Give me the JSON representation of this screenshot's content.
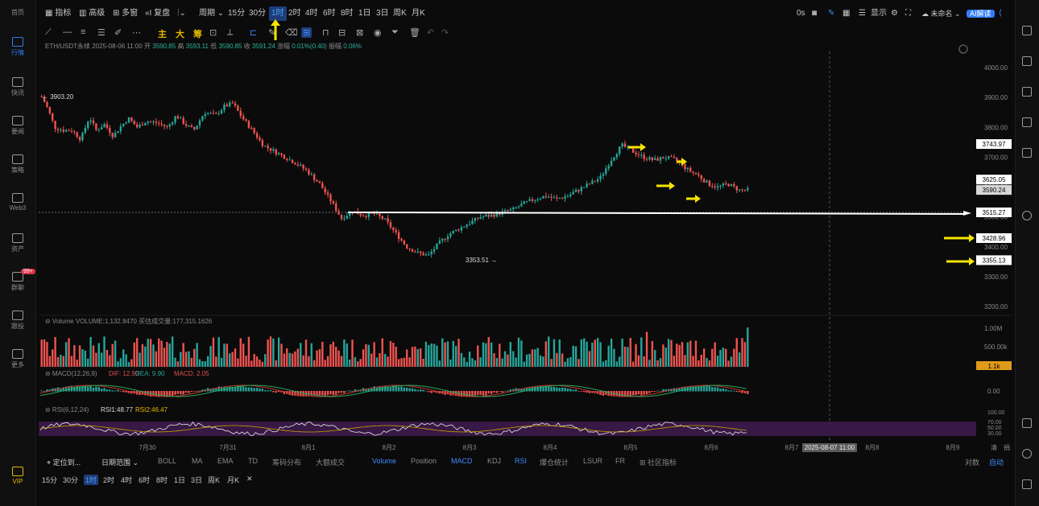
{
  "sidebar": {
    "items": [
      {
        "label": "首页",
        "icon": "home-icon"
      },
      {
        "label": "行情",
        "icon": "chart-icon",
        "active": true
      },
      {
        "label": "快讯",
        "icon": "news-icon"
      },
      {
        "label": "要闻",
        "icon": "article-icon"
      },
      {
        "label": "策略",
        "icon": "strategy-icon"
      },
      {
        "label": "Web3",
        "icon": "web3-icon"
      },
      {
        "label": "资产",
        "icon": "wallet-icon"
      },
      {
        "label": "群聊",
        "icon": "chat-icon",
        "badge": "99+"
      },
      {
        "label": "跟投",
        "icon": "copy-icon"
      },
      {
        "label": "更多",
        "icon": "more-icon"
      },
      {
        "label": "VIP",
        "icon": "vip-icon"
      }
    ]
  },
  "toolbar": {
    "indicators": "指标",
    "advanced": "高级",
    "multi": "多窗",
    "replay": "复盘",
    "period": "周期",
    "intervals": [
      "15分",
      "30分",
      "1时",
      "2时",
      "4时",
      "6时",
      "8时",
      "1日",
      "3日",
      "周K",
      "月K"
    ],
    "selected_interval": "1时",
    "right_status": "0s",
    "display": "显示",
    "layout_name": "未命名",
    "ai_button": "AI解读"
  },
  "drawing_tools": {
    "main": "主",
    "big": "大",
    "chips": "筹"
  },
  "ohlc": {
    "symbol": "ETH/USDT永续 2025-08-06 11:00",
    "open_label": "开",
    "open": "3590.85",
    "high_label": "高",
    "high": "3593.11",
    "low_label": "低",
    "low": "3590.85",
    "close_label": "收",
    "close": "3591.24",
    "change_label": "涨幅",
    "change": "0.01%(0.40)",
    "amp_label": "振幅",
    "amp": "0.06%"
  },
  "price_axis": [
    "4000.00",
    "3900.00",
    "3800.00",
    "3700.00",
    "3600.00",
    "3500.00",
    "3400.00",
    "3300.00",
    "3200.00"
  ],
  "price_labels": {
    "high_marker": "3903.20",
    "low_marker": "3353.51",
    "box1": "3743.97",
    "box2": "3625.05",
    "box3": "3515.27",
    "box4": "3428.96",
    "box5": "3355.13",
    "box_partial": "3590.24"
  },
  "volume_panel": {
    "label": "Volume VOLUME:1,132.8470",
    "sub": "买估成交量:177,315.1626",
    "axis": [
      "1.00M",
      "500.00k",
      "0.00"
    ],
    "current": "1.1k"
  },
  "macd_panel": {
    "label": "MACD(12,26,9)",
    "dif": "DIF: 12.90",
    "dea": "DEA: 9.90",
    "macd": "MACD: 2.05",
    "axis": [
      "0.00"
    ]
  },
  "rsi_panel": {
    "label": "RSI(6,12,24)",
    "rsi1": "RSI1:48.77",
    "rsi2": "RSI2:46.47",
    "axis": [
      "100.00",
      "70.00",
      "50.00",
      "30.00"
    ]
  },
  "time_axis": [
    "7月30",
    "7月31",
    "8月1",
    "8月2",
    "8月3",
    "8月4",
    "8月5",
    "8月6",
    "8月7",
    "8月8",
    "8月9"
  ],
  "crosshair_time": "2025-08-07 11:00",
  "time_axis_right": [
    "清",
    "捐"
  ],
  "bottom_bar": {
    "locate": "定位到...",
    "date_range": "日期范围",
    "indicators": [
      "BOLL",
      "MA",
      "EMA",
      "TD",
      "筹码分布",
      "大额成交",
      "Volume",
      "Position",
      "MACD",
      "KDJ",
      "RSI",
      "爆仓统计",
      "LSUR",
      "FR",
      "社区指标"
    ],
    "active": [
      "Volume",
      "MACD",
      "RSI"
    ],
    "right": [
      "对数",
      "自动"
    ]
  },
  "bottom_intervals": [
    "15分",
    "30分",
    "1时",
    "2时",
    "4时",
    "6时",
    "8时",
    "1日",
    "3日",
    "周K",
    "月K"
  ],
  "colors": {
    "up": "#26a69a",
    "down": "#ef5350",
    "accent": "#2f7cf6",
    "arrow": "#f5e400",
    "rsi_band": "#3d1a4a"
  },
  "chart_data": {
    "type": "candlestick",
    "symbol": "ETH/USDT永续",
    "interval": "1时",
    "ylim": [
      3150,
      4050
    ],
    "dates": [
      "7月30",
      "7月31",
      "8月1",
      "8月2",
      "8月3",
      "8月4",
      "8月5",
      "8月6"
    ],
    "price_path": [
      [
        0,
        3903
      ],
      [
        6,
        3860
      ],
      [
        12,
        3800
      ],
      [
        20,
        3790
      ],
      [
        28,
        3790
      ],
      [
        36,
        3760
      ],
      [
        44,
        3835
      ],
      [
        50,
        3790
      ],
      [
        58,
        3810
      ],
      [
        66,
        3770
      ],
      [
        72,
        3800
      ],
      [
        80,
        3830
      ],
      [
        88,
        3800
      ],
      [
        96,
        3820
      ],
      [
        106,
        3815
      ],
      [
        116,
        3800
      ],
      [
        124,
        3840
      ],
      [
        132,
        3810
      ],
      [
        140,
        3790
      ],
      [
        150,
        3850
      ],
      [
        160,
        3840
      ],
      [
        168,
        3870
      ],
      [
        176,
        3880
      ],
      [
        184,
        3835
      ],
      [
        194,
        3790
      ],
      [
        204,
        3740
      ],
      [
        214,
        3720
      ],
      [
        224,
        3700
      ],
      [
        234,
        3680
      ],
      [
        244,
        3655
      ],
      [
        256,
        3610
      ],
      [
        266,
        3555
      ],
      [
        276,
        3495
      ],
      [
        286,
        3520
      ],
      [
        296,
        3505
      ],
      [
        306,
        3510
      ],
      [
        316,
        3490
      ],
      [
        326,
        3445
      ],
      [
        336,
        3400
      ],
      [
        346,
        3380
      ],
      [
        356,
        3370
      ],
      [
        364,
        3405
      ],
      [
        374,
        3440
      ],
      [
        384,
        3460
      ],
      [
        394,
        3480
      ],
      [
        404,
        3500
      ],
      [
        414,
        3505
      ],
      [
        424,
        3515
      ],
      [
        434,
        3525
      ],
      [
        444,
        3545
      ],
      [
        454,
        3560
      ],
      [
        464,
        3570
      ],
      [
        474,
        3560
      ],
      [
        484,
        3570
      ],
      [
        494,
        3590
      ],
      [
        504,
        3610
      ],
      [
        514,
        3630
      ],
      [
        524,
        3690
      ],
      [
        534,
        3740
      ],
      [
        544,
        3720
      ],
      [
        554,
        3700
      ],
      [
        564,
        3690
      ],
      [
        574,
        3700
      ],
      [
        584,
        3690
      ],
      [
        594,
        3660
      ],
      [
        604,
        3640
      ],
      [
        614,
        3610
      ],
      [
        622,
        3600
      ],
      [
        632,
        3610
      ],
      [
        642,
        3590
      ],
      [
        650,
        3590
      ]
    ],
    "support_line": 3515.27,
    "high": 3903.2,
    "low": 3353.51
  }
}
